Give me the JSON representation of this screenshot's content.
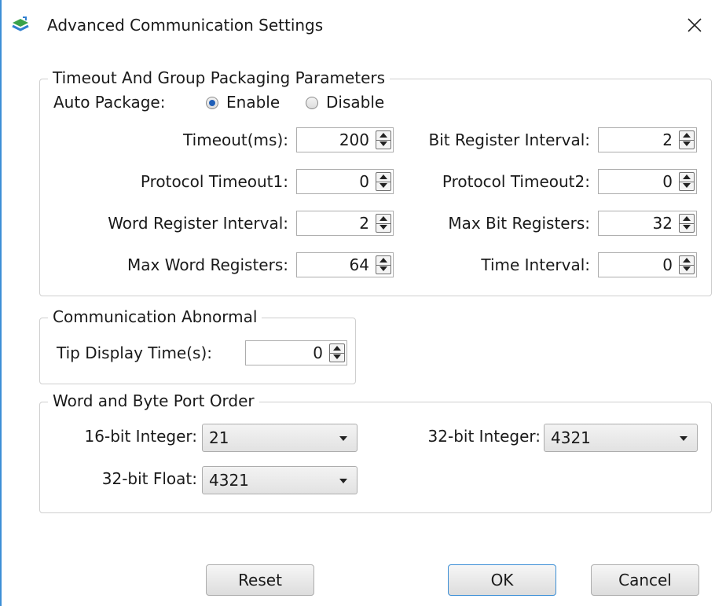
{
  "window": {
    "title": "Advanced Communication Settings"
  },
  "timeout_group": {
    "title": "Timeout And Group Packaging Parameters",
    "auto_package_label": "Auto Package:",
    "enable_label": "Enable",
    "disable_label": "Disable",
    "auto_package_selected": "Enable",
    "fields": {
      "timeout": {
        "label": "Timeout(ms):",
        "value": "200"
      },
      "bit_register_interval": {
        "label": "Bit Register Interval:",
        "value": "2"
      },
      "protocol_timeout1": {
        "label": "Protocol Timeout1:",
        "value": "0"
      },
      "protocol_timeout2": {
        "label": "Protocol Timeout2:",
        "value": "0"
      },
      "word_register_interval": {
        "label": "Word Register Interval:",
        "value": "2"
      },
      "max_bit_registers": {
        "label": "Max Bit Registers:",
        "value": "32"
      },
      "max_word_registers": {
        "label": "Max Word Registers:",
        "value": "64"
      },
      "time_interval": {
        "label": "Time Interval:",
        "value": "0"
      }
    }
  },
  "comm_abnormal_group": {
    "title": "Communication Abnormal",
    "tip_display_time": {
      "label": "Tip Display Time(s):",
      "value": "0"
    }
  },
  "byte_order_group": {
    "title": "Word and Byte Port Order",
    "int16": {
      "label": "16-bit Integer:",
      "value": "21"
    },
    "int32": {
      "label": "32-bit Integer:",
      "value": "4321"
    },
    "float32": {
      "label": "32-bit Float:",
      "value": "4321"
    }
  },
  "buttons": {
    "reset": "Reset",
    "ok": "OK",
    "cancel": "Cancel"
  },
  "colors": {
    "accent": "#3c8fd6",
    "radio_selected": "#1f5fb8"
  }
}
